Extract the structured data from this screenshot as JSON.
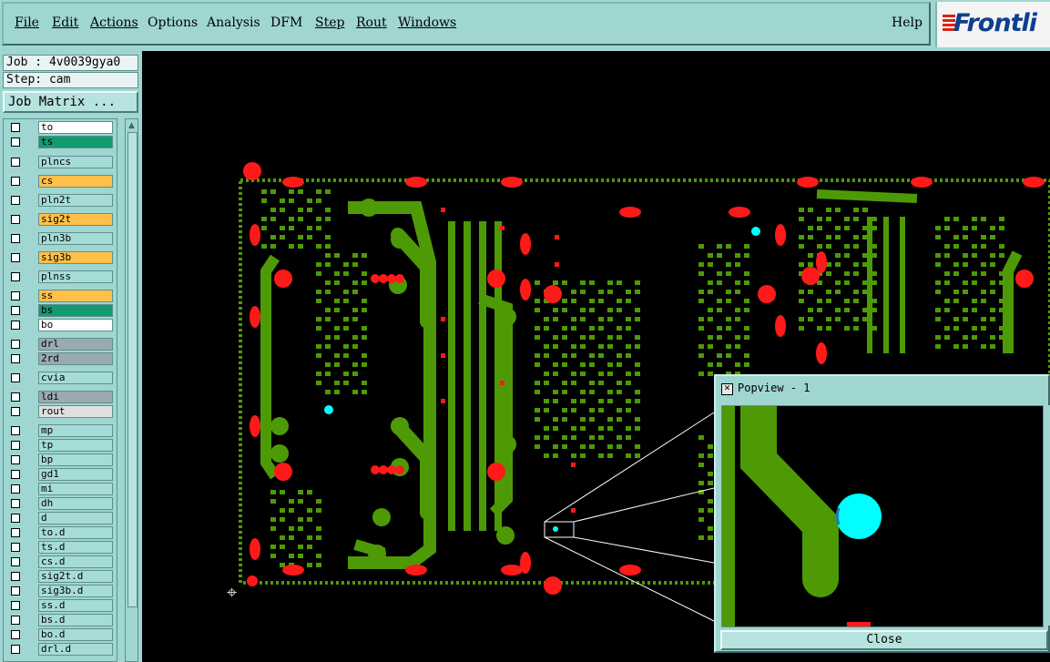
{
  "menu": [
    "File",
    "Edit",
    "Actions",
    "Options",
    "Analysis",
    "DFM",
    "Step",
    "Rout",
    "Windows"
  ],
  "help_label": "Help",
  "logo_text": "Frontli",
  "job_label": "Job : 4v0039gya0",
  "step_label": "Step: cam",
  "job_matrix_label": "Job Matrix ...",
  "layers": [
    {
      "name": "to",
      "color": "#ffffff"
    },
    {
      "name": "ts",
      "color": "#129a72"
    },
    {
      "name": "plncs",
      "color": "#a6dcd8"
    },
    {
      "name": "cs",
      "color": "#ffc04a"
    },
    {
      "name": "pln2t",
      "color": "#a6dcd8"
    },
    {
      "name": "sig2t",
      "color": "#ffc04a"
    },
    {
      "name": "pln3b",
      "color": "#a6dcd8"
    },
    {
      "name": "sig3b",
      "color": "#ffc04a"
    },
    {
      "name": "plnss",
      "color": "#a6dcd8"
    },
    {
      "name": "ss",
      "color": "#ffc04a"
    },
    {
      "name": "bs",
      "color": "#129a72"
    },
    {
      "name": "bo",
      "color": "#ffffff"
    },
    {
      "name": "drl",
      "color": "#9aa9b2"
    },
    {
      "name": "2rd",
      "color": "#9aa9b2"
    },
    {
      "name": "cvia",
      "color": "#a6dcd8"
    },
    {
      "name": "ldi",
      "color": "#9aa9b2"
    },
    {
      "name": "rout",
      "color": "#e0e0e0"
    },
    {
      "name": "mp",
      "color": "#a6dcd8"
    },
    {
      "name": "tp",
      "color": "#a6dcd8"
    },
    {
      "name": "bp",
      "color": "#a6dcd8"
    },
    {
      "name": "gd1",
      "color": "#a6dcd8"
    },
    {
      "name": "mi",
      "color": "#a6dcd8"
    },
    {
      "name": "dh",
      "color": "#a6dcd8"
    },
    {
      "name": "d",
      "color": "#a6dcd8"
    },
    {
      "name": "to.d",
      "color": "#a6dcd8"
    },
    {
      "name": "ts.d",
      "color": "#a6dcd8"
    },
    {
      "name": "cs.d",
      "color": "#a6dcd8"
    },
    {
      "name": "sig2t.d",
      "color": "#a6dcd8"
    },
    {
      "name": "sig3b.d",
      "color": "#a6dcd8"
    },
    {
      "name": "ss.d",
      "color": "#a6dcd8"
    },
    {
      "name": "bs.d",
      "color": "#a6dcd8"
    },
    {
      "name": "bo.d",
      "color": "#a6dcd8"
    },
    {
      "name": "drl.d",
      "color": "#a6dcd8"
    }
  ],
  "popview": {
    "title": "Popview - 1",
    "close_label": "Close"
  },
  "colors": {
    "panel": "#9fd6d2",
    "copper": "#4e9a06",
    "pad_red": "#ff1a1a",
    "highlight": "#00ffff"
  }
}
